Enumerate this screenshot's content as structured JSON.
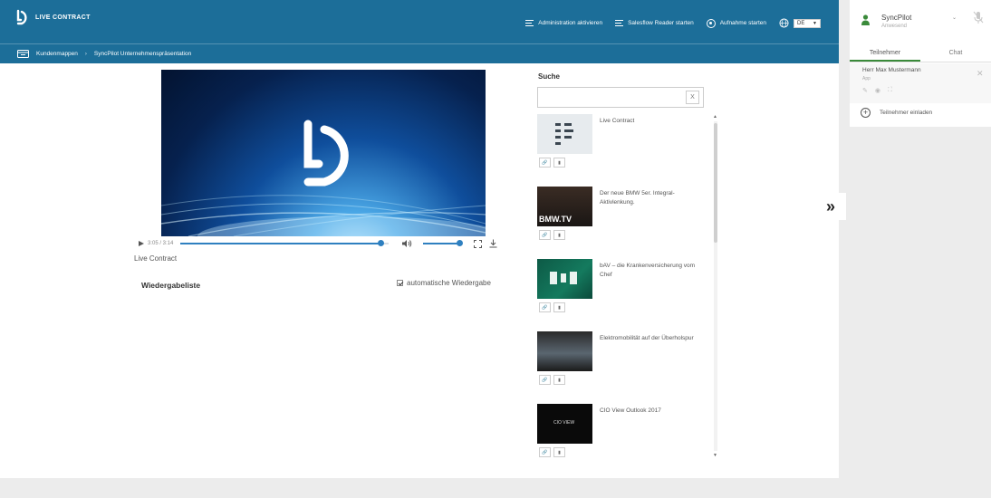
{
  "header": {
    "logo_text": "LIVE CONTRACT",
    "actions": {
      "admin": "Administration aktivieren",
      "reader": "Salesflow Reader starten",
      "record": "Aufnahme starten"
    },
    "language": "DE",
    "breadcrumb": {
      "root": "Kundenmappen",
      "current": "SyncPilot Unternehmenspräsentation"
    }
  },
  "player": {
    "time": "3:05 / 3:14",
    "progress": 0.96,
    "volume": 1.0,
    "title": "Live Contract",
    "playlist_label": "Wiedergabeliste",
    "autoplay_label": "automatische Wiedergabe",
    "autoplay_checked": true
  },
  "search": {
    "label": "Suche",
    "value": "",
    "placeholder": "",
    "clear_label": "X",
    "results": [
      {
        "title": "Live Contract",
        "thumb_tag": ""
      },
      {
        "title": "Der neue BMW 5er. Integral-Aktivlenkung.",
        "thumb_tag": "BMW.TV"
      },
      {
        "title": "bAV – die Krankenversicherung vom Chef",
        "thumb_tag": ""
      },
      {
        "title": "Elektromobilität auf der Überholspur",
        "thumb_tag": ""
      },
      {
        "title": "CIO View Outlook 2017",
        "thumb_tag": "CIO VIEW"
      }
    ]
  },
  "side_panel": {
    "user_name": "SyncPilot",
    "user_status": "Anwesend",
    "tabs": [
      "Teilnehmer",
      "Chat"
    ],
    "active_tab": 0,
    "participant_name": "Herr Max Mustermann",
    "participant_role": "App",
    "invite_label": "Teilnehmer einladen"
  },
  "colors": {
    "header": "#1c6e99",
    "accent": "#2f80c0",
    "tab_active": "#3a8a3a"
  }
}
